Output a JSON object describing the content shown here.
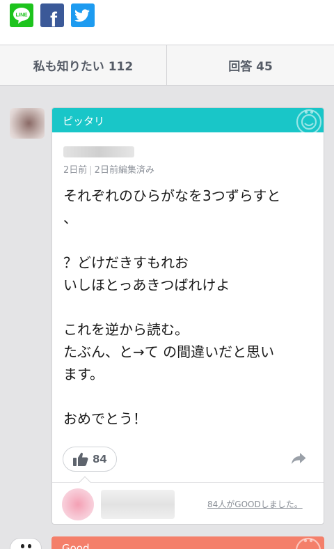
{
  "share": {
    "line_label": "LINE",
    "facebook_glyph": "f",
    "icons": [
      "line-icon",
      "facebook-icon",
      "twitter-icon"
    ]
  },
  "tabs": {
    "want_to_know": "私も知りたい 112",
    "answers": "回答 45"
  },
  "answer": {
    "header_label": "ピッタリ",
    "meta_posted": "2日前",
    "meta_edited": "2日前編集済み",
    "body_lines": [
      "それぞれのひらがなを3つずらすと",
      "、",
      "",
      "？どけだきすもれお",
      "いしほとっあきつばれけよ",
      "",
      "これを逆から読む。",
      "たぶん、と→て の間違いだと思い",
      "ます。",
      "",
      "おめでとう！"
    ],
    "good_count": "84",
    "liked_text": "84人がGOODしました。"
  },
  "next_answer": {
    "header_label": "Good"
  },
  "colors": {
    "pittari_header": "#19c6c8",
    "good_header": "#f47f6a",
    "line_green": "#1dc31d",
    "facebook_blue": "#3b5998",
    "twitter_blue": "#1d9bf0"
  }
}
